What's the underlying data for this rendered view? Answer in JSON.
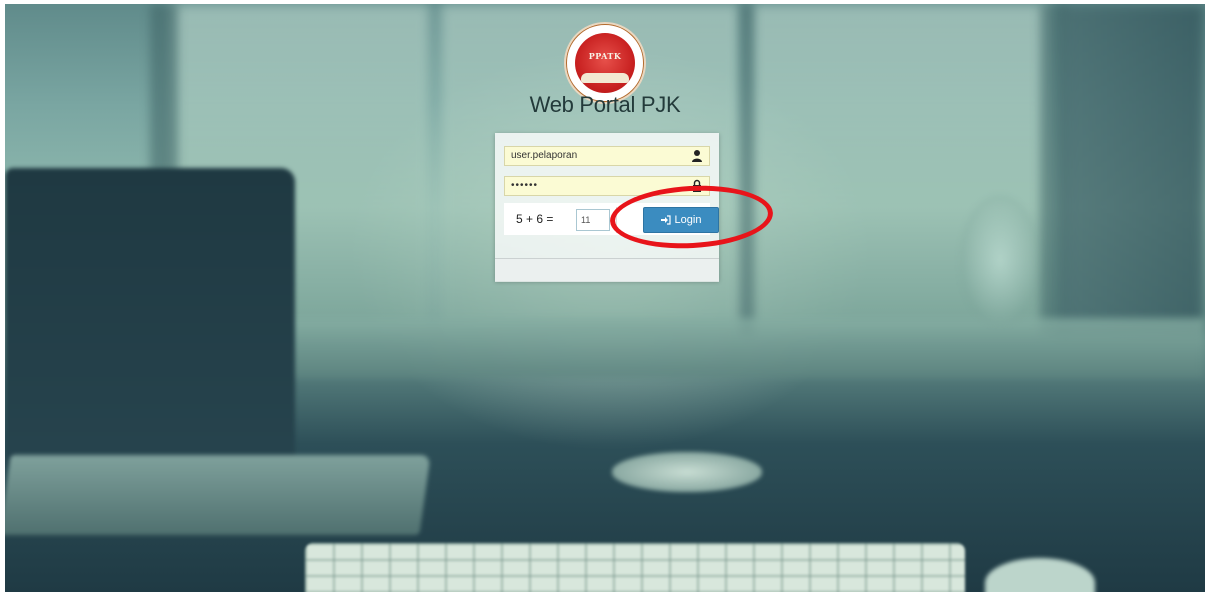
{
  "app": {
    "title": "Web Portal PJK",
    "logo_text": "PPATK"
  },
  "login": {
    "username_value": "user.pelaporan",
    "password_value": "••••••",
    "captcha_question": "5 + 6 =",
    "captcha_answer": "11",
    "login_button_label": "Login"
  },
  "icons": {
    "user": "user-icon",
    "lock": "lock-icon",
    "sign_in": "sign-in-icon"
  },
  "colors": {
    "login_button": "#3b8cc0",
    "input_background": "#fbfbd4",
    "highlight_annotation": "#e8141a"
  }
}
